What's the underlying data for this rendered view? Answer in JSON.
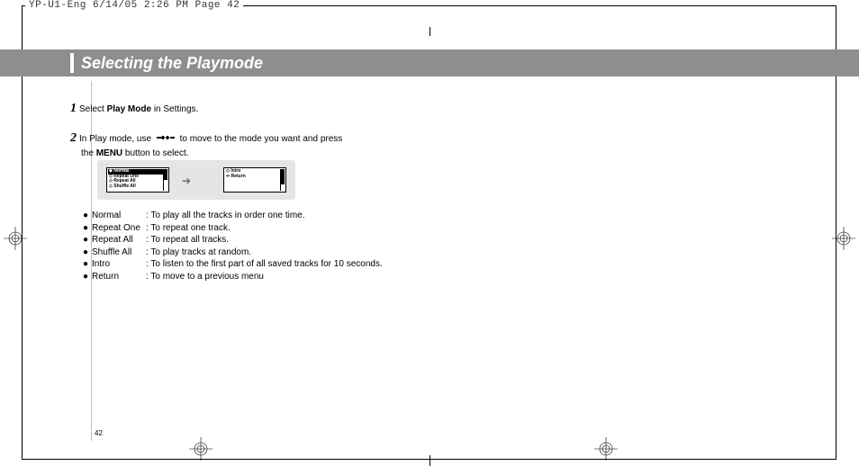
{
  "print_header": "YP-U1-Eng  6/14/05 2:26 PM  Page 42",
  "title": "Selecting the Playmode",
  "page_number": "42",
  "steps": {
    "s1_num": "1",
    "s1_a": "Select ",
    "s1_b": "Play Mode",
    "s1_c": " in Settings.",
    "s2_num": "2",
    "s2_a": "In Play mode, use ",
    "s2_b": " to move to the mode you want and press",
    "s2_c": "the ",
    "s2_d": "MENU",
    "s2_e": " button to select."
  },
  "lcd_left": [
    "Normal",
    "Repeat One",
    "Repeat All",
    "Shuffle All"
  ],
  "lcd_right": [
    "Intro",
    "Return"
  ],
  "modes": [
    {
      "name": "Normal",
      "desc": ": To play all the tracks in order one time."
    },
    {
      "name": "Repeat One",
      "desc": ": To repeat one track."
    },
    {
      "name": "Repeat All",
      "desc": ": To repeat all tracks."
    },
    {
      "name": "Shuffle All",
      "desc": ": To play tracks at random."
    },
    {
      "name": "Intro",
      "desc": ": To listen to the first part of all saved tracks for 10 seconds."
    },
    {
      "name": "Return",
      "desc": ": To move to a previous menu"
    }
  ]
}
